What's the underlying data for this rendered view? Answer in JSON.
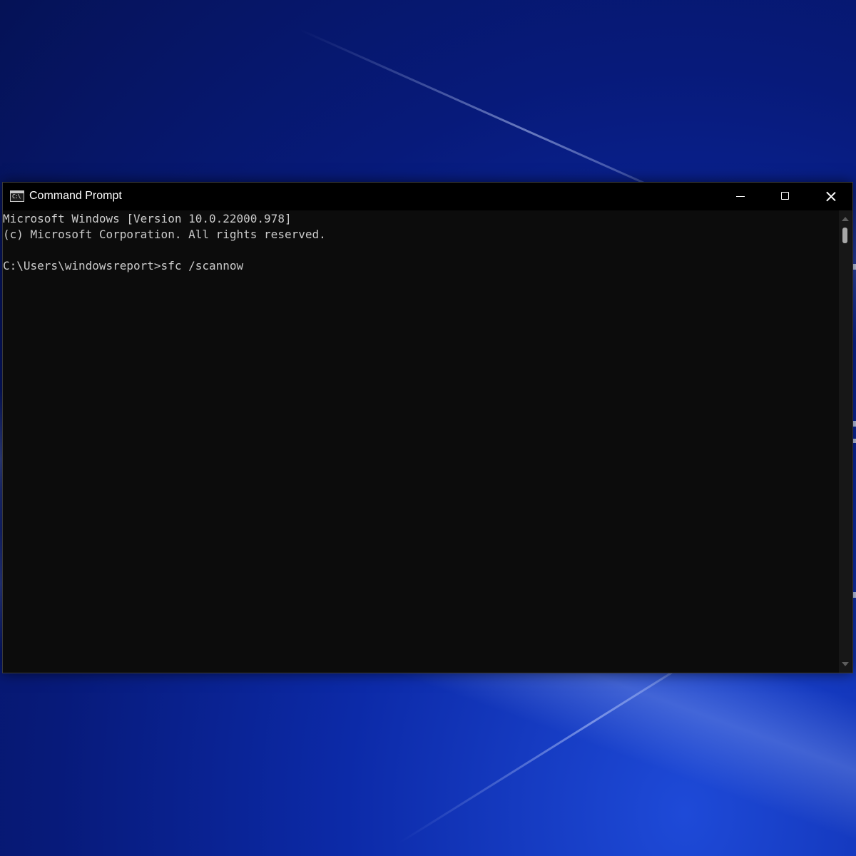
{
  "window": {
    "title": "Command Prompt",
    "icon": "command-prompt-icon",
    "icon_glyph": "C:\\"
  },
  "caption_buttons": {
    "minimize": "minimize-icon",
    "maximize": "maximize-icon",
    "close": "close-icon"
  },
  "console": {
    "lines": [
      "Microsoft Windows [Version 10.0.22000.978]",
      "(c) Microsoft Corporation. All rights reserved.",
      "",
      "C:\\Users\\windowsreport>sfc /scannow"
    ],
    "text_color": "#cccccc",
    "background_color": "#0c0c0c"
  },
  "desktop": {
    "background_color": "#0a1f8f"
  }
}
